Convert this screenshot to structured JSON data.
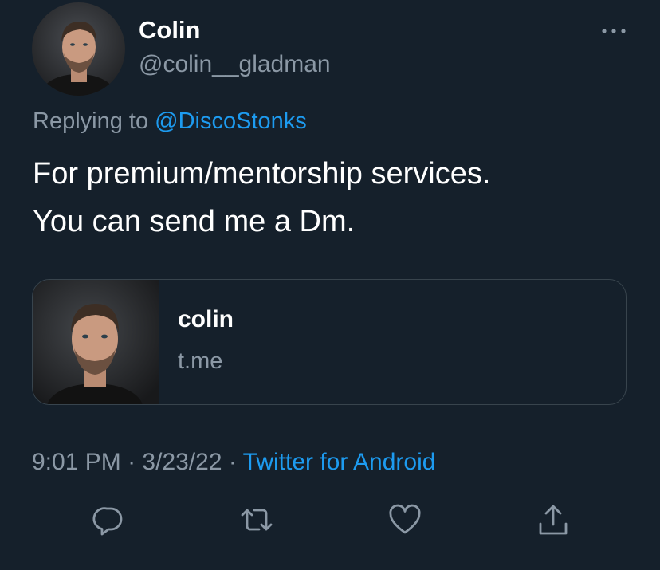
{
  "tweet": {
    "author": {
      "display_name": "Colin",
      "handle": "@colin__gladman",
      "avatar_icon": "profile-photo-man-beard"
    },
    "more_icon": "more-horizontal-icon",
    "reply_context": {
      "prefix": "Replying to",
      "mention": "@DiscoStonks"
    },
    "text_lines": [
      "For premium/mentorship services.",
      "You can send me a Dm."
    ],
    "link_card": {
      "title": "colin",
      "domain": "t.me",
      "thumbnail_icon": "profile-photo-man-beard"
    },
    "meta": {
      "time": "9:01 PM",
      "separator": "·",
      "date": "3/23/22",
      "source": "Twitter for Android"
    },
    "actions": [
      {
        "name": "reply",
        "icon": "reply-bubble-icon"
      },
      {
        "name": "retweet",
        "icon": "retweet-icon"
      },
      {
        "name": "like",
        "icon": "heart-icon"
      },
      {
        "name": "share",
        "icon": "share-upload-icon"
      }
    ]
  },
  "colors": {
    "background": "#15202b",
    "text": "#ffffff",
    "secondary": "#8b98a5",
    "accent": "#1d9bf0",
    "border": "#38444d"
  }
}
